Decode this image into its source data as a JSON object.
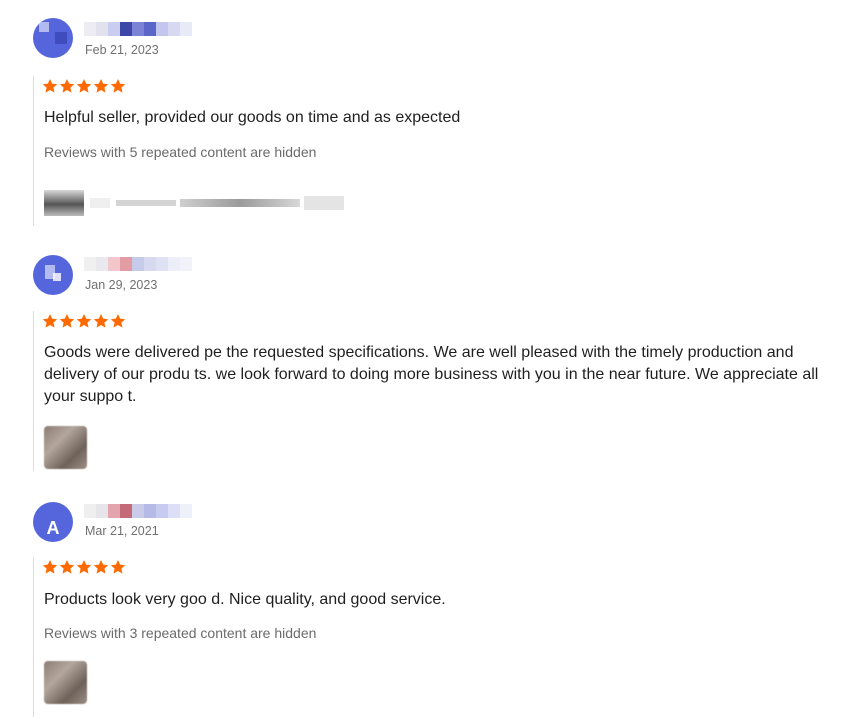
{
  "reviews": [
    {
      "date": "Feb 21, 2023",
      "rating": 5,
      "text": "Helpful seller, provided our goods on time and as expected",
      "hidden_note": "Reviews with 5 repeated content are hidden",
      "avatar_letter": ""
    },
    {
      "date": "Jan 29, 2023",
      "rating": 5,
      "text": "Goods were delivered pe  the requested specifications. We are well pleased with the timely production and delivery of our produ  ts. we look forward to doing more business with you in the near future. We appreciate all your suppo  t.",
      "hidden_note": "",
      "avatar_letter": ""
    },
    {
      "date": "Mar 21, 2021",
      "rating": 5,
      "text": "Products look very goo d. Nice quality, and good service.",
      "hidden_note": "Reviews with 3 repeated content are hidden",
      "avatar_letter": "A"
    }
  ],
  "colors": {
    "star": "#ff6a00",
    "avatar": "#5566dd",
    "muted_text": "#6b6b6b"
  },
  "icons": {
    "star": "star-icon"
  }
}
